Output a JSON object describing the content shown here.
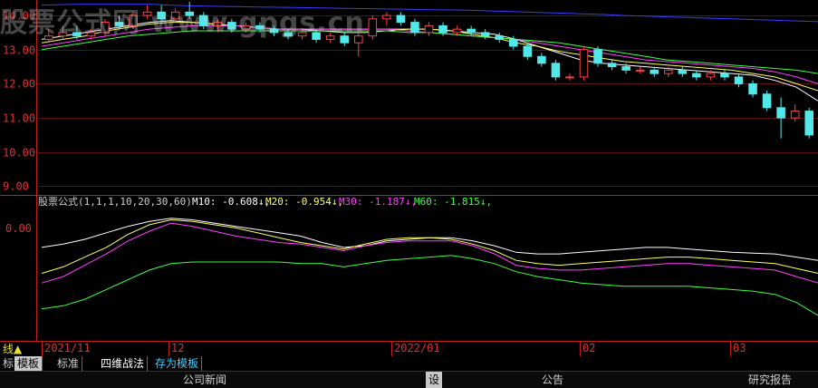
{
  "watermark": "股票公式网 www.gpgs.cn",
  "price_axis": {
    "labels": [
      "14.00",
      "13.00",
      "12.00",
      "11.00",
      "10.00",
      "9.00"
    ],
    "values": [
      14,
      13,
      12,
      11,
      10,
      9
    ]
  },
  "indicator_axis": {
    "labels": [
      "0.00"
    ]
  },
  "indicator_header": {
    "formula": "股票公式(1,1,1,10,20,30,60)",
    "m10": "M10: -0.608↓,",
    "m20": "M20: -0.954↓,",
    "m30": "M30: -1.187↓,",
    "m60": "M60: -1.815↓,"
  },
  "time_axis": {
    "labels": [
      "2021/11",
      "12",
      "2022/01",
      "02",
      "03"
    ]
  },
  "corner_label": "线▲",
  "tabs": {
    "items": [
      "标",
      "模板",
      "标准",
      "四维战法",
      "存为模板"
    ],
    "selected_index": 1
  },
  "bottom_bar": {
    "company_news": "公司新闻",
    "settings": "设",
    "announcement": "公告",
    "research": "研究报告"
  },
  "colors": {
    "up": "#ff4040",
    "down": "#50e8e8",
    "m10": "#ffffff",
    "m20": "#ffff60",
    "m30": "#ff40ff",
    "m60": "#40ff40",
    "ma_blue": "#3a3aff",
    "axis": "#c02020"
  },
  "chart_data": {
    "type": "candlestick",
    "ylim": [
      8.8,
      14.4
    ],
    "candles": [
      {
        "o": 13.3,
        "h": 13.6,
        "l": 13.2,
        "c": 13.4
      },
      {
        "o": 13.4,
        "h": 13.7,
        "l": 13.3,
        "c": 13.5
      },
      {
        "o": 13.5,
        "h": 13.7,
        "l": 13.3,
        "c": 13.4
      },
      {
        "o": 13.4,
        "h": 13.6,
        "l": 13.3,
        "c": 13.5
      },
      {
        "o": 13.5,
        "h": 13.9,
        "l": 13.4,
        "c": 13.8
      },
      {
        "o": 13.8,
        "h": 14.0,
        "l": 13.6,
        "c": 13.7
      },
      {
        "o": 13.7,
        "h": 14.1,
        "l": 13.6,
        "c": 14.0
      },
      {
        "o": 14.0,
        "h": 14.3,
        "l": 13.9,
        "c": 14.1
      },
      {
        "o": 14.1,
        "h": 14.3,
        "l": 13.8,
        "c": 13.9
      },
      {
        "o": 13.9,
        "h": 14.2,
        "l": 13.8,
        "c": 14.1
      },
      {
        "o": 14.1,
        "h": 14.4,
        "l": 13.9,
        "c": 14.0
      },
      {
        "o": 14.0,
        "h": 14.1,
        "l": 13.6,
        "c": 13.7
      },
      {
        "o": 13.7,
        "h": 13.9,
        "l": 13.5,
        "c": 13.8
      },
      {
        "o": 13.8,
        "h": 13.9,
        "l": 13.5,
        "c": 13.6
      },
      {
        "o": 13.6,
        "h": 13.8,
        "l": 13.5,
        "c": 13.7
      },
      {
        "o": 13.7,
        "h": 13.8,
        "l": 13.5,
        "c": 13.6
      },
      {
        "o": 13.6,
        "h": 13.7,
        "l": 13.4,
        "c": 13.5
      },
      {
        "o": 13.5,
        "h": 13.6,
        "l": 13.3,
        "c": 13.4
      },
      {
        "o": 13.4,
        "h": 13.6,
        "l": 13.3,
        "c": 13.5
      },
      {
        "o": 13.5,
        "h": 13.6,
        "l": 13.2,
        "c": 13.3
      },
      {
        "o": 13.3,
        "h": 13.5,
        "l": 13.2,
        "c": 13.4
      },
      {
        "o": 13.4,
        "h": 13.5,
        "l": 13.1,
        "c": 13.2
      },
      {
        "o": 13.2,
        "h": 13.5,
        "l": 12.8,
        "c": 13.4
      },
      {
        "o": 13.4,
        "h": 14.0,
        "l": 13.3,
        "c": 13.9
      },
      {
        "o": 13.9,
        "h": 14.1,
        "l": 13.7,
        "c": 14.0
      },
      {
        "o": 14.0,
        "h": 14.1,
        "l": 13.7,
        "c": 13.8
      },
      {
        "o": 13.8,
        "h": 13.9,
        "l": 13.4,
        "c": 13.5
      },
      {
        "o": 13.5,
        "h": 13.8,
        "l": 13.4,
        "c": 13.7
      },
      {
        "o": 13.7,
        "h": 13.8,
        "l": 13.4,
        "c": 13.5
      },
      {
        "o": 13.5,
        "h": 13.7,
        "l": 13.4,
        "c": 13.6
      },
      {
        "o": 13.6,
        "h": 13.7,
        "l": 13.4,
        "c": 13.5
      },
      {
        "o": 13.5,
        "h": 13.6,
        "l": 13.3,
        "c": 13.4
      },
      {
        "o": 13.4,
        "h": 13.5,
        "l": 13.2,
        "c": 13.3
      },
      {
        "o": 13.3,
        "h": 13.4,
        "l": 13.0,
        "c": 13.1
      },
      {
        "o": 13.1,
        "h": 13.2,
        "l": 12.7,
        "c": 12.8
      },
      {
        "o": 12.8,
        "h": 12.9,
        "l": 12.5,
        "c": 12.6
      },
      {
        "o": 12.6,
        "h": 12.7,
        "l": 12.1,
        "c": 12.2
      },
      {
        "o": 12.2,
        "h": 12.3,
        "l": 12.1,
        "c": 12.2
      },
      {
        "o": 12.2,
        "h": 13.1,
        "l": 12.1,
        "c": 13.0
      },
      {
        "o": 13.0,
        "h": 13.1,
        "l": 12.5,
        "c": 12.6
      },
      {
        "o": 12.6,
        "h": 12.7,
        "l": 12.4,
        "c": 12.5
      },
      {
        "o": 12.5,
        "h": 12.6,
        "l": 12.3,
        "c": 12.4
      },
      {
        "o": 12.4,
        "h": 12.5,
        "l": 12.3,
        "c": 12.4
      },
      {
        "o": 12.4,
        "h": 12.5,
        "l": 12.2,
        "c": 12.3
      },
      {
        "o": 12.3,
        "h": 12.5,
        "l": 12.2,
        "c": 12.4
      },
      {
        "o": 12.4,
        "h": 12.5,
        "l": 12.2,
        "c": 12.3
      },
      {
        "o": 12.3,
        "h": 12.4,
        "l": 12.1,
        "c": 12.2
      },
      {
        "o": 12.2,
        "h": 12.4,
        "l": 12.1,
        "c": 12.3
      },
      {
        "o": 12.3,
        "h": 12.4,
        "l": 12.1,
        "c": 12.2
      },
      {
        "o": 12.2,
        "h": 12.3,
        "l": 11.9,
        "c": 12.0
      },
      {
        "o": 12.0,
        "h": 12.1,
        "l": 11.6,
        "c": 11.7
      },
      {
        "o": 11.7,
        "h": 11.8,
        "l": 11.2,
        "c": 11.3
      },
      {
        "o": 11.3,
        "h": 11.6,
        "l": 10.4,
        "c": 11.0
      },
      {
        "o": 11.0,
        "h": 11.4,
        "l": 10.9,
        "c": 11.2
      },
      {
        "o": 11.2,
        "h": 11.3,
        "l": 10.4,
        "c": 10.5
      }
    ],
    "ma": {
      "m10": [
        13.3,
        13.4,
        13.5,
        13.6,
        13.7,
        13.8,
        13.85,
        13.8,
        13.75,
        13.7,
        13.65,
        13.6,
        13.6,
        13.55,
        13.5,
        13.5,
        13.55,
        13.6,
        13.6,
        13.55,
        13.5,
        13.45,
        13.3,
        13.1,
        12.9,
        12.7,
        12.6,
        12.55,
        12.5,
        12.45,
        12.4,
        12.35,
        12.3,
        12.25,
        12.1,
        11.9,
        11.5
      ],
      "m20": [
        13.2,
        13.3,
        13.4,
        13.55,
        13.65,
        13.75,
        13.8,
        13.8,
        13.75,
        13.7,
        13.65,
        13.6,
        13.6,
        13.6,
        13.6,
        13.6,
        13.6,
        13.6,
        13.6,
        13.55,
        13.45,
        13.35,
        13.2,
        13.1,
        12.95,
        12.85,
        12.75,
        12.65,
        12.6,
        12.55,
        12.5,
        12.45,
        12.4,
        12.3,
        12.2,
        12.0,
        11.8
      ],
      "m30": [
        13.1,
        13.2,
        13.3,
        13.4,
        13.5,
        13.6,
        13.65,
        13.7,
        13.7,
        13.7,
        13.65,
        13.6,
        13.6,
        13.6,
        13.6,
        13.6,
        13.6,
        13.55,
        13.5,
        13.45,
        13.4,
        13.35,
        13.3,
        13.2,
        13.1,
        13.0,
        12.9,
        12.8,
        12.7,
        12.65,
        12.6,
        12.55,
        12.5,
        12.45,
        12.35,
        12.2,
        12.0
      ],
      "m60": [
        13.0,
        13.1,
        13.2,
        13.3,
        13.4,
        13.45,
        13.5,
        13.55,
        13.55,
        13.55,
        13.55,
        13.55,
        13.55,
        13.55,
        13.55,
        13.55,
        13.55,
        13.5,
        13.5,
        13.45,
        13.4,
        13.35,
        13.3,
        13.25,
        13.2,
        13.1,
        13.0,
        12.9,
        12.8,
        12.7,
        12.65,
        12.6,
        12.55,
        12.5,
        12.45,
        12.4,
        12.3
      ],
      "m120": [
        14.3,
        14.32,
        14.33,
        14.33,
        14.33,
        14.33,
        14.3,
        14.28,
        14.27,
        14.26,
        14.25,
        14.24,
        14.23,
        14.22,
        14.21,
        14.2,
        14.19,
        14.18,
        14.17,
        14.16,
        14.15,
        14.13,
        14.11,
        14.09,
        14.07,
        14.05,
        14.03,
        14.0,
        13.98,
        13.96,
        13.94,
        13.92,
        13.9,
        13.88,
        13.86,
        13.84,
        13.82
      ]
    },
    "indicator": {
      "ylim": [
        -3.2,
        0.8
      ],
      "m10": [
        -0.4,
        -0.3,
        -0.15,
        0.05,
        0.25,
        0.4,
        0.5,
        0.45,
        0.35,
        0.25,
        0.15,
        0.05,
        -0.05,
        -0.25,
        -0.4,
        -0.35,
        -0.2,
        -0.15,
        -0.1,
        -0.1,
        -0.2,
        -0.35,
        -0.55,
        -0.6,
        -0.6,
        -0.55,
        -0.5,
        -0.45,
        -0.4,
        -0.4,
        -0.45,
        -0.5,
        -0.55,
        -0.58,
        -0.6,
        -0.7,
        -0.8
      ],
      "m20": [
        -1.2,
        -1.0,
        -0.7,
        -0.4,
        0.0,
        0.3,
        0.45,
        0.4,
        0.3,
        0.2,
        0.05,
        -0.1,
        -0.25,
        -0.35,
        -0.45,
        -0.3,
        -0.15,
        -0.1,
        -0.1,
        -0.15,
        -0.3,
        -0.5,
        -0.8,
        -0.9,
        -0.95,
        -0.9,
        -0.85,
        -0.8,
        -0.75,
        -0.7,
        -0.7,
        -0.75,
        -0.8,
        -0.85,
        -0.9,
        -1.05,
        -1.2
      ],
      "m30": [
        -1.5,
        -1.3,
        -0.95,
        -0.6,
        -0.2,
        0.1,
        0.35,
        0.25,
        0.1,
        -0.05,
        -0.15,
        -0.25,
        -0.3,
        -0.4,
        -0.5,
        -0.35,
        -0.25,
        -0.2,
        -0.2,
        -0.2,
        -0.35,
        -0.6,
        -0.95,
        -1.05,
        -1.1,
        -1.1,
        -1.05,
        -1.0,
        -0.95,
        -0.9,
        -0.9,
        -0.95,
        -1.0,
        -1.05,
        -1.1,
        -1.3,
        -1.5
      ],
      "m60": [
        -2.3,
        -2.2,
        -2.0,
        -1.7,
        -1.4,
        -1.1,
        -0.9,
        -0.85,
        -0.85,
        -0.85,
        -0.85,
        -0.85,
        -0.9,
        -0.9,
        -1.0,
        -0.9,
        -0.8,
        -0.75,
        -0.7,
        -0.65,
        -0.75,
        -0.9,
        -1.15,
        -1.3,
        -1.4,
        -1.5,
        -1.55,
        -1.6,
        -1.6,
        -1.6,
        -1.6,
        -1.65,
        -1.7,
        -1.75,
        -1.85,
        -2.1,
        -2.5
      ]
    }
  }
}
